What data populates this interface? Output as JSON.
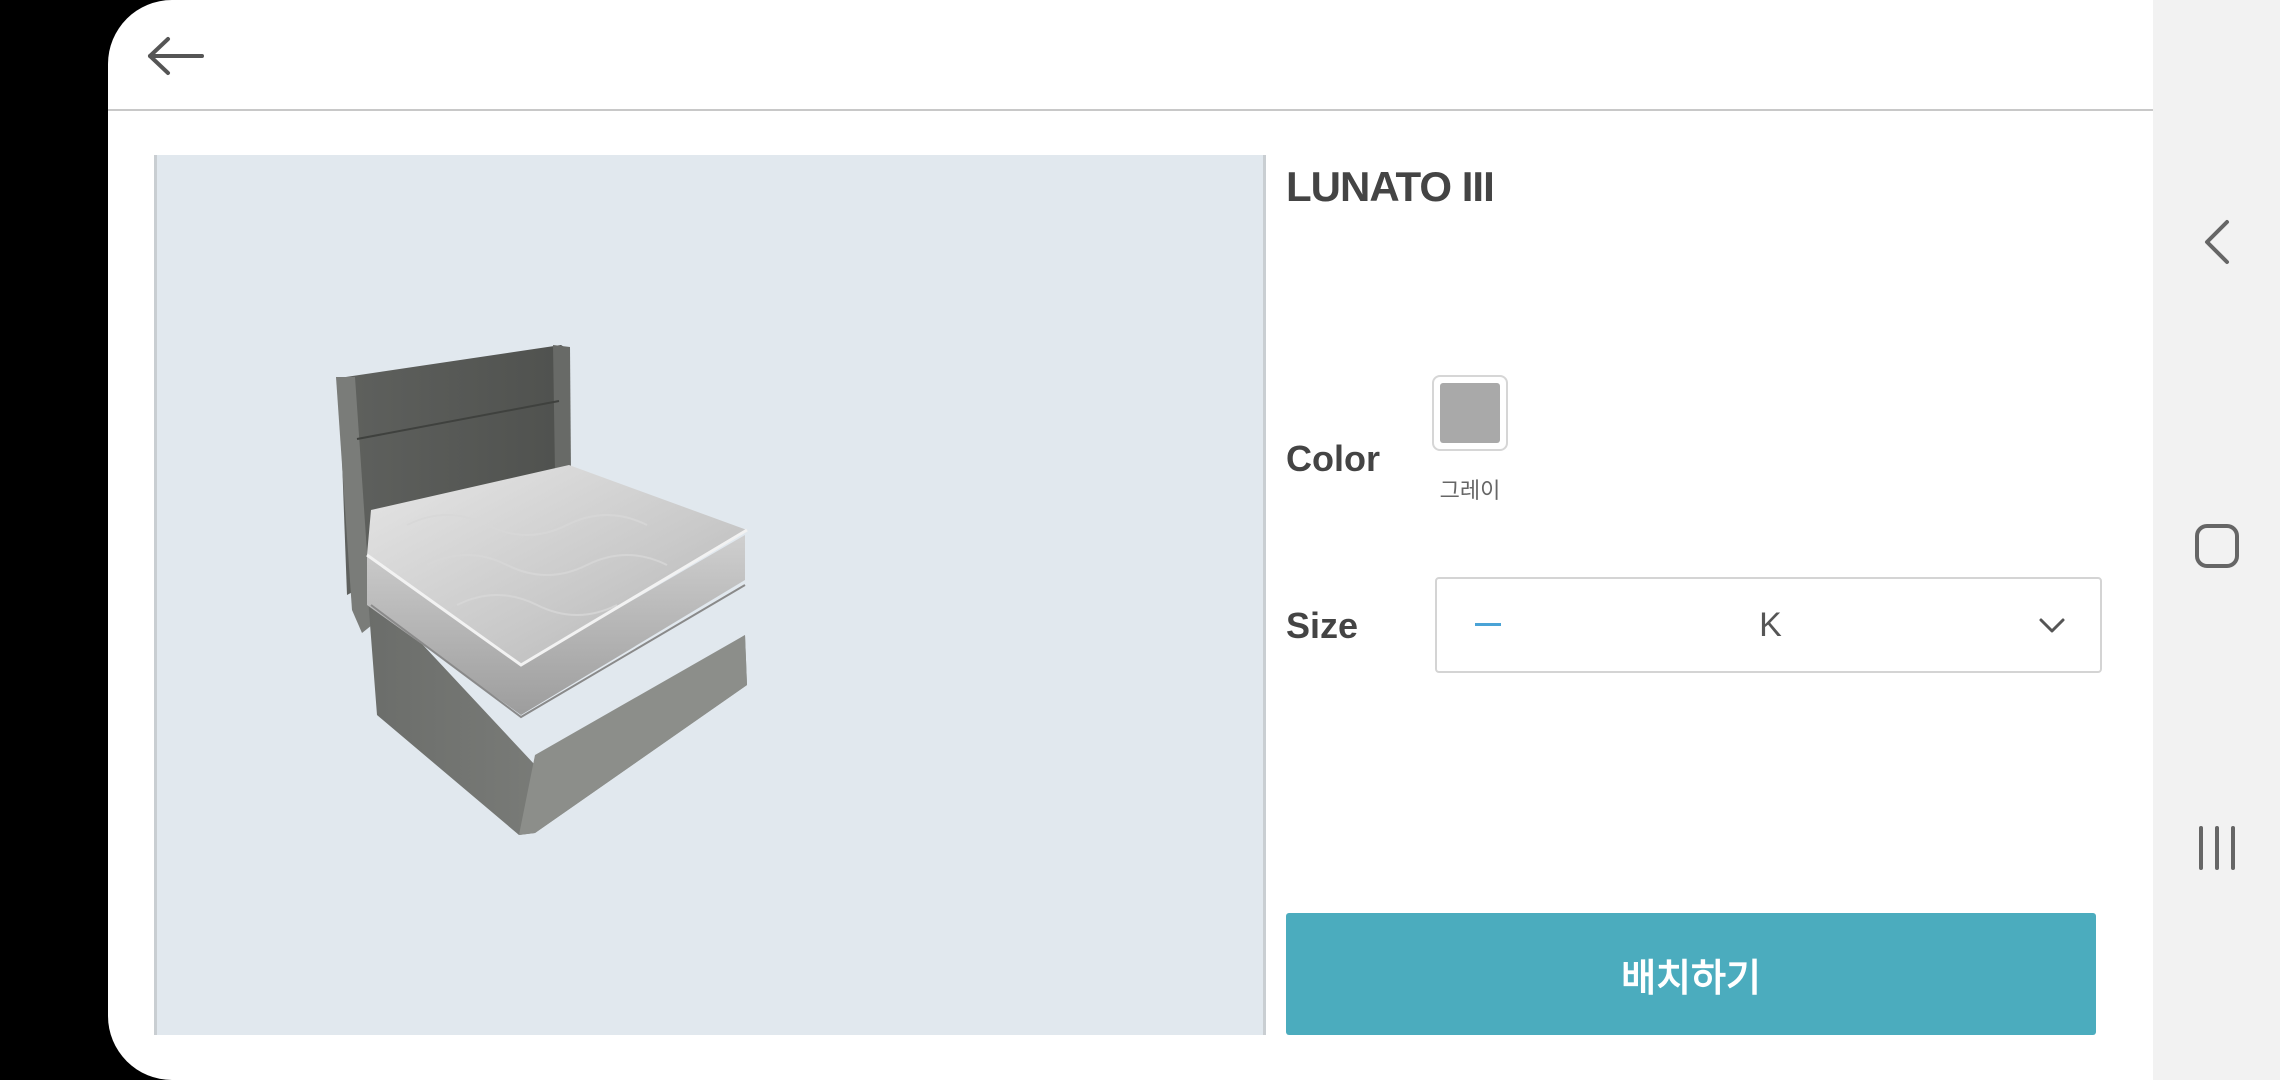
{
  "product": {
    "name": "LUNATO III"
  },
  "options": {
    "color_label": "Color",
    "color_swatches": [
      {
        "name": "그레이",
        "hex": "#a9a9a9",
        "selected": true
      }
    ],
    "size_label": "Size",
    "size_value": "K"
  },
  "actions": {
    "place_label": "배치하기"
  },
  "colors": {
    "accent": "#4bacbe",
    "viewer_bg": "#e1e8ee",
    "swatch_gray": "#a9a9a9",
    "dash_blue": "#4aa3d6"
  },
  "icons": {
    "back": "arrow-left-icon",
    "dropdown": "chevron-down-icon",
    "nav_back": "nav-back-icon",
    "nav_home": "nav-home-icon",
    "nav_recents": "nav-recents-icon"
  }
}
